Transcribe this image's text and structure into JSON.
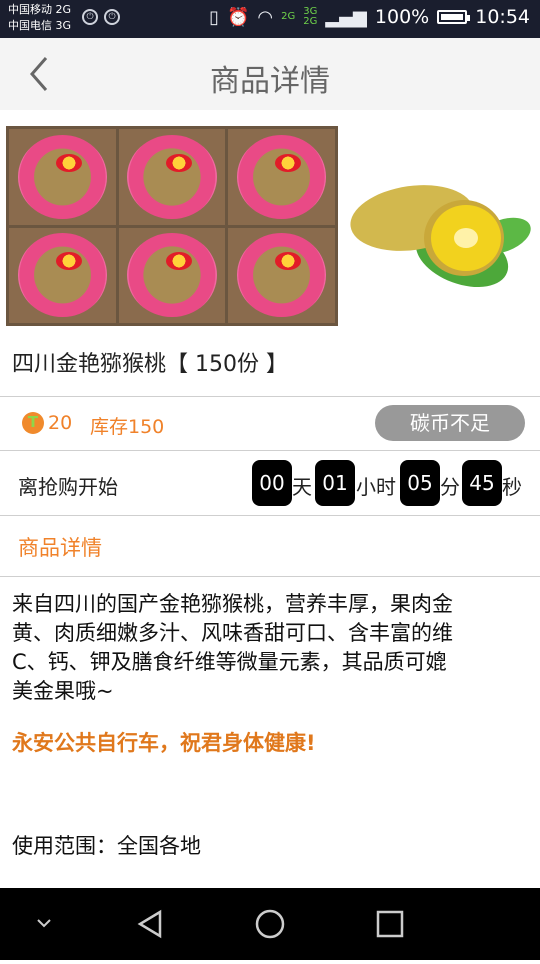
{
  "status_bar": {
    "carrier1": "中国移动 2G",
    "carrier2": "中国电信 3G",
    "net_top": "2G",
    "net_sim2": "3G",
    "net_sim2b": "2G",
    "battery": "100%",
    "time": "10:54"
  },
  "header": {
    "title": "商品详情",
    "back_icon": "chevron-left-icon"
  },
  "product": {
    "name": "四川金艳猕猴桃【 150份 】",
    "price": "20",
    "stock": "库存150",
    "button": "碳币不足",
    "coin_icon": "t-coin-icon"
  },
  "countdown": {
    "label": "离抢购开始",
    "days": "00",
    "day_unit": "天",
    "hours": "01",
    "hour_unit": "小时",
    "minutes": "05",
    "minute_unit": "分",
    "seconds": "45",
    "second_unit": "秒"
  },
  "details": {
    "section_title": "商品详情",
    "description_line1": "来自四川的国产金艳猕猴桃，营养丰厚，果肉金",
    "description_line2": "黄、肉质细嫩多汁、风味香甜可口、含丰富的维",
    "description_line3": "C、钙、钾及膳食纤维等微量元素，其品质可媲",
    "description_line4": "美金果哦~",
    "slogan": "永安公共自行车，祝君身体健康!",
    "scope": "使用范围：全国各地"
  },
  "colors": {
    "accent": "#f0822a",
    "status_bar": "#1a1e2e",
    "button_gray": "#999999"
  }
}
